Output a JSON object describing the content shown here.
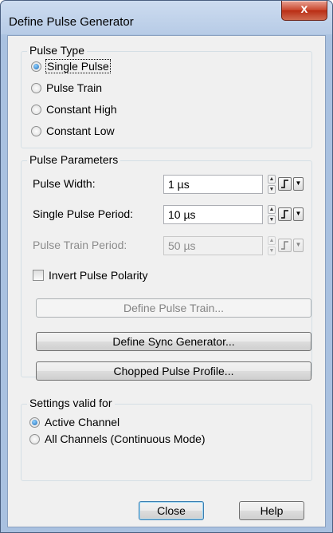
{
  "window": {
    "title": "Define Pulse Generator",
    "close_glyph": "x"
  },
  "pulse_type": {
    "title": "Pulse Type",
    "options": [
      {
        "label": "Single Pulse",
        "selected": true
      },
      {
        "label": "Pulse Train",
        "selected": false
      },
      {
        "label": "Constant High",
        "selected": false
      },
      {
        "label": "Constant Low",
        "selected": false
      }
    ]
  },
  "pulse_parameters": {
    "title": "Pulse Parameters",
    "pulse_width_label": "Pulse Width:",
    "pulse_width_value": "1 µs",
    "single_period_label": "Single Pulse Period:",
    "single_period_value": "10 µs",
    "train_period_label": "Pulse Train Period:",
    "train_period_value": "50 µs",
    "invert_label": "Invert Pulse Polarity",
    "invert_checked": false,
    "define_train_label": "Define Pulse Train...",
    "define_sync_label": "Define Sync Generator...",
    "chopped_label": "Chopped Pulse Profile..."
  },
  "settings_valid_for": {
    "title": "Settings valid for",
    "options": [
      {
        "label": "Active Channel",
        "selected": true
      },
      {
        "label": "All Channels (Continuous Mode)",
        "selected": false
      }
    ]
  },
  "footer": {
    "close_label": "Close",
    "help_label": "Help"
  },
  "colors": {
    "frame": "#a9c1e0",
    "client": "#f0f0f0",
    "close_button": "#c8442b",
    "radio_selected": "#1f6cb6"
  }
}
